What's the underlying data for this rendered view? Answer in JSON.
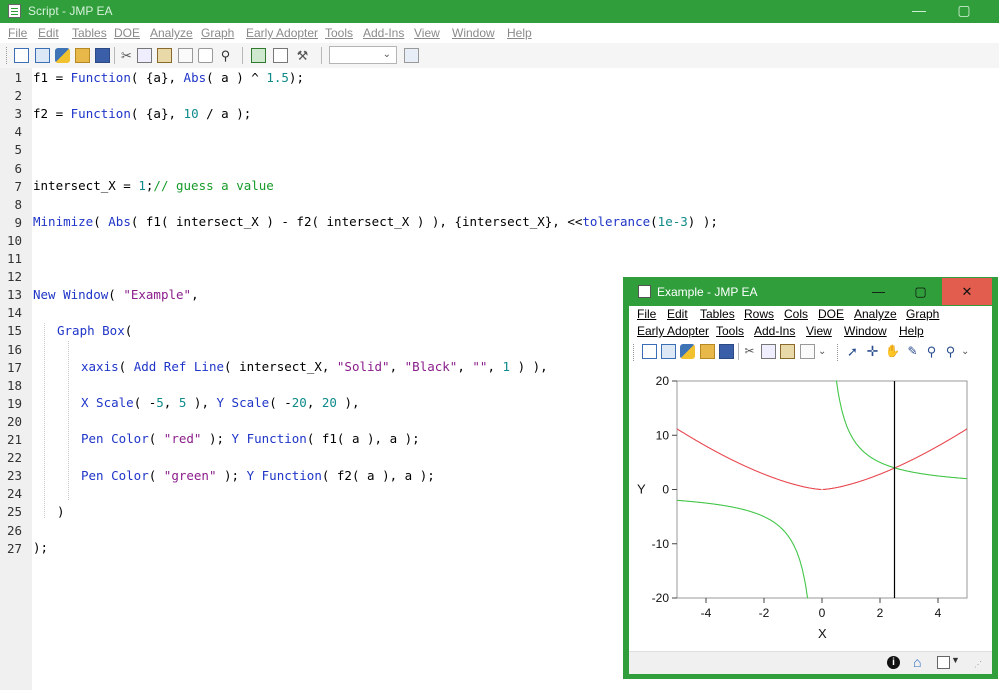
{
  "main_window": {
    "title": "Script - JMP EA",
    "min_glyph": "—",
    "max_glyph": "▢",
    "menu": [
      {
        "label": "File"
      },
      {
        "label": "Edit"
      },
      {
        "label": "Tables"
      },
      {
        "label": "DOE"
      },
      {
        "label": "Analyze"
      },
      {
        "label": "Graph"
      },
      {
        "label": "Early Adopter"
      },
      {
        "label": "Tools"
      },
      {
        "label": "Add-Ins"
      },
      {
        "label": "View"
      },
      {
        "label": "Window"
      },
      {
        "label": "Help"
      }
    ],
    "toolbar_icons": [
      "new-data-table-icon",
      "new-script-icon",
      "python-icon",
      "open-folder-icon",
      "save-icon",
      "cut-icon",
      "copy-icon",
      "paste-icon",
      "page-icon",
      "lock-icon",
      "search-icon",
      "run-script-icon",
      "script-page-icon",
      "wrench-icon"
    ],
    "combo_value": ""
  },
  "editor": {
    "line_numbers": [
      "1",
      "2",
      "3",
      "4",
      "5",
      "6",
      "7",
      "8",
      "9",
      "10",
      "11",
      "12",
      "13",
      "14",
      "15",
      "16",
      "17",
      "18",
      "19",
      "20",
      "21",
      "22",
      "23",
      "24",
      "25",
      "26",
      "27"
    ],
    "lines": {
      "l1": {
        "a": "f1 = ",
        "b": "Function",
        "c": "( {a}, ",
        "d": "Abs",
        "e": "( a ) ^ ",
        "f": "1.5",
        "g": ");"
      },
      "l3": {
        "a": "f2 = ",
        "b": "Function",
        "c": "( {a}, ",
        "d": "10",
        "e": " / a );"
      },
      "l7": {
        "a": "intersect_X = ",
        "b": "1",
        "c": ";",
        "d": "// guess a value"
      },
      "l9": {
        "a": "Minimize",
        "b": "( ",
        "c": "Abs",
        "d": "( f1( intersect_X ) - f2( intersect_X ) ), {intersect_X}, <<",
        "e": "tolerance",
        "f": "(",
        "g": "1e-3",
        "h": ") );"
      },
      "l13": {
        "a": "New Window",
        "b": "( ",
        "c": "\"Example\"",
        "d": ","
      },
      "l15": {
        "a": "Graph Box",
        "b": "("
      },
      "l17": {
        "a": "xaxis",
        "b": "( ",
        "c": "Add Ref Line",
        "d": "( intersect_X, ",
        "e": "\"Solid\"",
        "f": ", ",
        "g": "\"Black\"",
        "h": ", ",
        "i": "\"\"",
        "j": ", ",
        "k": "1",
        "l": " ) ),"
      },
      "l19": {
        "a": "X Scale",
        "b": "( -",
        "c": "5",
        "d": ", ",
        "e": "5",
        "f": " ), ",
        "g": "Y Scale",
        "h": "( -",
        "i": "20",
        "j": ", ",
        "k": "20",
        "l": " ),"
      },
      "l21": {
        "a": "Pen Color",
        "b": "( ",
        "c": "\"red\"",
        "d": " ); ",
        "e": "Y Function",
        "f": "( f1( a ), a );"
      },
      "l23": {
        "a": "Pen Color",
        "b": "( ",
        "c": "\"green\"",
        "d": " ); ",
        "e": "Y Function",
        "f": "( f2( a ), a );"
      },
      "l25": {
        "a": ")"
      },
      "l27": {
        "a": ");"
      }
    }
  },
  "graph_window": {
    "title": "Example - JMP EA",
    "min_glyph": "—",
    "max_glyph": "▢",
    "close_glyph": "✕",
    "menu_row1": [
      {
        "label": "File"
      },
      {
        "label": "Edit"
      },
      {
        "label": "Tables"
      },
      {
        "label": "Rows"
      },
      {
        "label": "Cols"
      },
      {
        "label": "DOE"
      },
      {
        "label": "Analyze"
      },
      {
        "label": "Graph"
      }
    ],
    "menu_row2": [
      {
        "label": "Early Adopter"
      },
      {
        "label": "Tools"
      },
      {
        "label": "Add-Ins"
      },
      {
        "label": "View"
      },
      {
        "label": "Window"
      },
      {
        "label": "Help"
      }
    ],
    "toolbar_icons": [
      "new-data-table-icon",
      "new-script-icon",
      "python-icon",
      "open-folder-icon",
      "save-icon",
      "cut-icon",
      "copy-icon",
      "paste-icon",
      "page-icon",
      "arrow-pointer-icon",
      "crosshair-icon",
      "hand-icon",
      "brush-icon",
      "lasso-icon",
      "magnifier-icon"
    ],
    "status_icons": [
      "info-icon",
      "home-icon",
      "checkbox-icon"
    ]
  },
  "chart_data": {
    "type": "line",
    "xlabel": "X",
    "ylabel": "Y",
    "xlim": [
      -5,
      5
    ],
    "ylim": [
      -20,
      20
    ],
    "x_ticks": [
      -4,
      -2,
      0,
      2,
      4
    ],
    "y_ticks": [
      -20,
      -10,
      0,
      10,
      20
    ],
    "x_tick_labels": [
      "-4",
      "-2",
      "0",
      "2",
      "4"
    ],
    "y_tick_labels": [
      "-20",
      "-10",
      "0",
      "10",
      "20"
    ],
    "grid": false,
    "ref_line_x": 2.5,
    "ref_line_color": "#000000",
    "series": [
      {
        "function": "abs(a)^1.5",
        "color": "#e8474f"
      },
      {
        "function": "10/a",
        "color": "#43c648"
      }
    ]
  }
}
